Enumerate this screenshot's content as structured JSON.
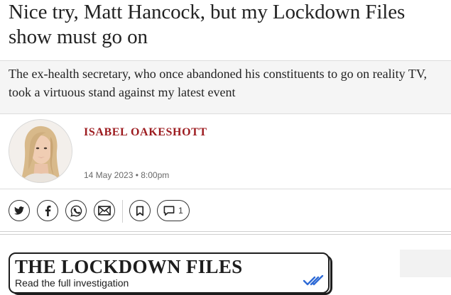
{
  "article": {
    "headline": "Nice try, Matt Hancock, but my Lockdown Files show must go on",
    "standfirst": "The ex-health secretary, who once abandoned his constituents to go on reality TV, took a virtuous stand against my latest event",
    "author": "ISABEL OAKESHOTT",
    "date": "14 May 2023 • 8:00pm"
  },
  "share": {
    "icons": [
      "twitter-icon",
      "facebook-icon",
      "whatsapp-icon",
      "email-icon",
      "bookmark-icon",
      "comment-icon"
    ],
    "comment_count": "1"
  },
  "promo": {
    "title": "THE LOCKDOWN FILES",
    "subtitle": "Read the full investigation",
    "check_color": "#2f6bd6"
  },
  "colors": {
    "byline": "#9c1b1f",
    "standfirst_bg": "#f5f5f5",
    "text": "#222222"
  }
}
